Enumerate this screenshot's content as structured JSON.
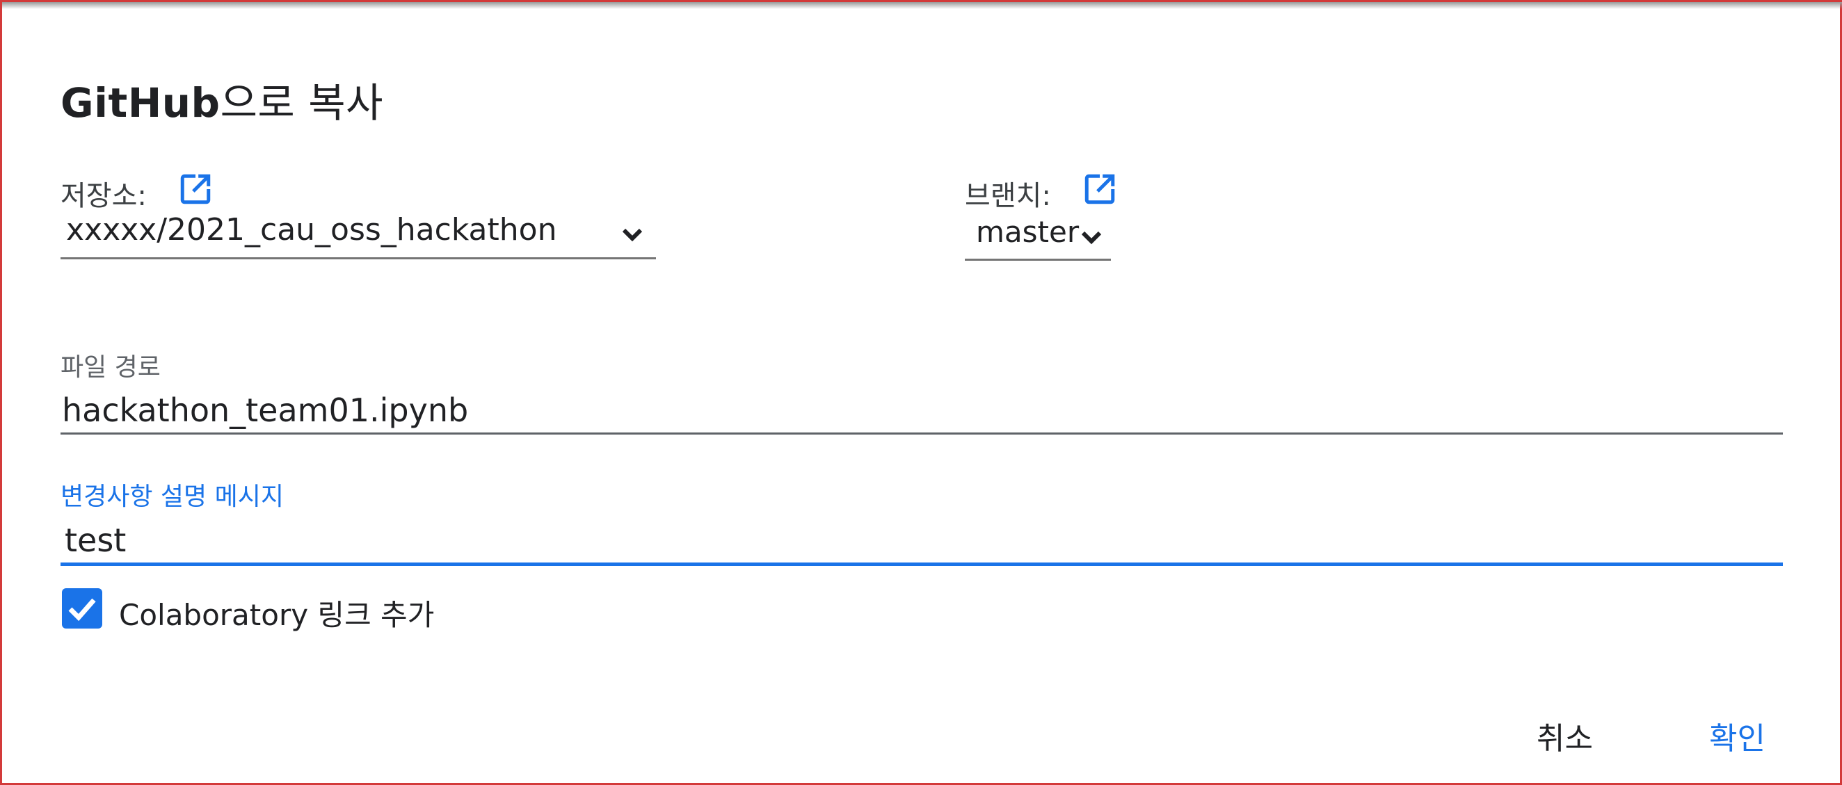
{
  "dialog": {
    "title_en": "GitHub",
    "title_ko": "으로 복사"
  },
  "repository": {
    "label": "저장소:",
    "value": "xxxxx/2021_cau_oss_hackathon",
    "open_icon": "open-in-new-icon"
  },
  "branch": {
    "label": "브랜치:",
    "value": "master",
    "open_icon": "open-in-new-icon"
  },
  "file_path": {
    "label": "파일 경로",
    "value": "hackathon_team01.ipynb"
  },
  "commit_message": {
    "label": "변경사항 설명 메시지",
    "value": "test"
  },
  "colab_link": {
    "label": "Colaboratory 링크 추가",
    "checked": true
  },
  "actions": {
    "cancel_label": "취소",
    "ok_label": "확인"
  },
  "colors": {
    "accent": "#1a73e8",
    "frame_border": "#d33a3a",
    "text": "#202124",
    "muted": "#5f6368"
  }
}
